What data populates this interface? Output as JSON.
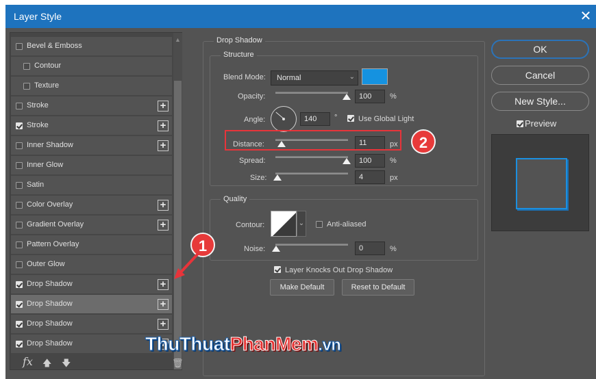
{
  "window": {
    "title": "Layer Style",
    "close_glyph": "✕"
  },
  "styles_list": {
    "items": [
      {
        "label": "Bevel & Emboss",
        "checked": false,
        "indent": false,
        "has_plus": false
      },
      {
        "label": "Contour",
        "checked": false,
        "indent": true,
        "has_plus": false
      },
      {
        "label": "Texture",
        "checked": false,
        "indent": true,
        "has_plus": false
      },
      {
        "label": "Stroke",
        "checked": false,
        "indent": false,
        "has_plus": true
      },
      {
        "label": "Stroke",
        "checked": true,
        "indent": false,
        "has_plus": true
      },
      {
        "label": "Inner Shadow",
        "checked": false,
        "indent": false,
        "has_plus": true
      },
      {
        "label": "Inner Glow",
        "checked": false,
        "indent": false,
        "has_plus": false
      },
      {
        "label": "Satin",
        "checked": false,
        "indent": false,
        "has_plus": false
      },
      {
        "label": "Color Overlay",
        "checked": false,
        "indent": false,
        "has_plus": true
      },
      {
        "label": "Gradient Overlay",
        "checked": false,
        "indent": false,
        "has_plus": true
      },
      {
        "label": "Pattern Overlay",
        "checked": false,
        "indent": false,
        "has_plus": false
      },
      {
        "label": "Outer Glow",
        "checked": false,
        "indent": false,
        "has_plus": false
      },
      {
        "label": "Drop Shadow",
        "checked": true,
        "indent": false,
        "has_plus": true
      },
      {
        "label": "Drop Shadow",
        "checked": true,
        "indent": false,
        "has_plus": true,
        "selected": true
      },
      {
        "label": "Drop Shadow",
        "checked": true,
        "indent": false,
        "has_plus": true
      },
      {
        "label": "Drop Shadow",
        "checked": true,
        "indent": false,
        "has_plus": true
      }
    ],
    "fx_label": "fx"
  },
  "drop_shadow": {
    "section_title": "Drop Shadow",
    "structure_title": "Structure",
    "blend_mode_label": "Blend Mode:",
    "blend_mode_value": "Normal",
    "shadow_color": "#1592e0",
    "opacity_label": "Opacity:",
    "opacity_value": "100",
    "opacity_unit": "%",
    "angle_label": "Angle:",
    "angle_value": "140",
    "angle_unit": "°",
    "use_global_light_label": "Use Global Light",
    "distance_label": "Distance:",
    "distance_value": "11",
    "distance_unit": "px",
    "spread_label": "Spread:",
    "spread_value": "100",
    "spread_unit": "%",
    "size_label": "Size:",
    "size_value": "4",
    "size_unit": "px",
    "quality_title": "Quality",
    "contour_label": "Contour:",
    "anti_aliased_label": "Anti-aliased",
    "noise_label": "Noise:",
    "noise_value": "0",
    "noise_unit": "%",
    "knocks_out_label": "Layer Knocks Out Drop Shadow",
    "make_default_label": "Make Default",
    "reset_default_label": "Reset to Default"
  },
  "actions": {
    "ok_label": "OK",
    "cancel_label": "Cancel",
    "new_style_label": "New Style...",
    "preview_label": "Preview"
  },
  "annotations": {
    "badge_1": "1",
    "badge_2": "2",
    "accent_red": "#e8343a"
  },
  "watermark": {
    "part1": "ThuThuat",
    "part2": "PhanMem",
    "part3": ".vn"
  }
}
